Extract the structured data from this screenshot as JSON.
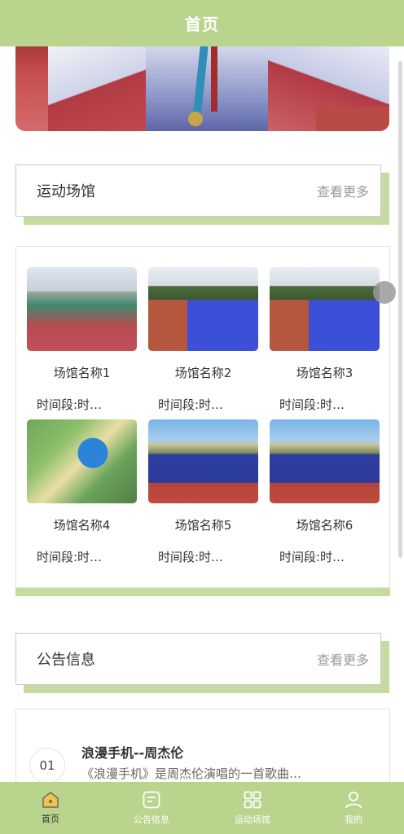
{
  "header": {
    "title": "首页"
  },
  "venues": {
    "title": "运动场馆",
    "more": "查看更多",
    "items": [
      {
        "name": "场馆名称1",
        "time": "时间段:时…",
        "image": "outdoor-court"
      },
      {
        "name": "场馆名称2",
        "time": "时间段:时…",
        "image": "blue-court"
      },
      {
        "name": "场馆名称3",
        "time": "时间段:时…",
        "image": "blue-court"
      },
      {
        "name": "场馆名称4",
        "time": "时间段:时…",
        "image": "aerial-park"
      },
      {
        "name": "场馆名称5",
        "time": "时间段:时…",
        "image": "blue-red-court"
      },
      {
        "name": "场馆名称6",
        "time": "时间段:时…",
        "image": "blue-red-court"
      }
    ]
  },
  "notices": {
    "title": "公告信息",
    "more": "查看更多",
    "items": [
      {
        "index": "01",
        "title": "浪漫手机--周杰伦",
        "desc": "《浪漫手机》是周杰伦演唱的一首歌曲…"
      }
    ]
  },
  "tabbar": {
    "items": [
      {
        "label": "首页",
        "icon": "home-icon",
        "active": true
      },
      {
        "label": "公告信息",
        "icon": "notice-icon",
        "active": false
      },
      {
        "label": "运动场馆",
        "icon": "grid-icon",
        "active": false
      },
      {
        "label": "我的",
        "icon": "user-icon",
        "active": false
      }
    ]
  },
  "colors": {
    "accent": "#b9d48d",
    "shadow": "#c6dba0",
    "active_icon": "#f0c34a"
  }
}
